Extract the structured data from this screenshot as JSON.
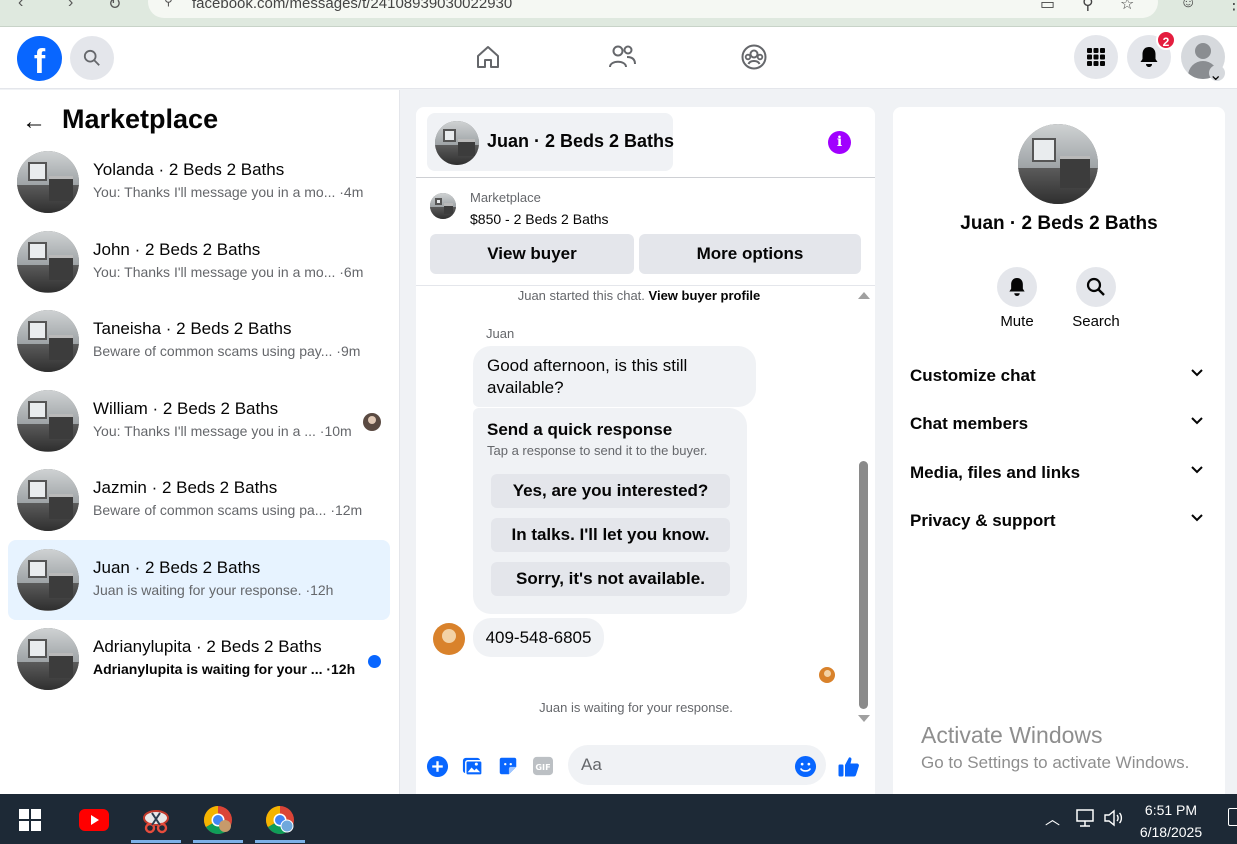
{
  "browser": {
    "url": "facebook.com/messages/t/24108939030022930"
  },
  "header": {
    "logo_letter": "f",
    "notification_count": "2"
  },
  "sidebar": {
    "title": "Marketplace",
    "conversations": [
      {
        "name": "Yolanda · 2 Beds 2 Baths",
        "preview": "You: Thanks I'll message you in a mo... ·4m",
        "active": false,
        "unread": false,
        "seen_avatar": false
      },
      {
        "name": "John · 2 Beds 2 Baths",
        "preview": "You: Thanks I'll message you in a mo... ·6m",
        "active": false,
        "unread": false,
        "seen_avatar": false
      },
      {
        "name": "Taneisha · 2 Beds 2 Baths",
        "preview": "Beware of common scams using pay... ·9m",
        "active": false,
        "unread": false,
        "seen_avatar": false
      },
      {
        "name": "William · 2 Beds 2 Baths",
        "preview": "You: Thanks I'll message you in a ... ·10m",
        "active": false,
        "unread": false,
        "seen_avatar": true
      },
      {
        "name": "Jazmin · 2 Beds 2 Baths",
        "preview": "Beware of common scams using pa... ·12m",
        "active": false,
        "unread": false,
        "seen_avatar": false
      },
      {
        "name": "Juan · 2 Beds 2 Baths",
        "preview": "Juan is waiting for your response. ·12h",
        "active": true,
        "unread": false,
        "seen_avatar": false
      },
      {
        "name": "Adrianylupita · 2 Beds 2 Baths",
        "preview": "Adrianylupita is waiting for your ... ·12h",
        "active": false,
        "unread": true,
        "seen_avatar": false
      }
    ]
  },
  "chat": {
    "title": "Juan · 2 Beds 2 Baths",
    "listing_label": "Marketplace",
    "listing_price": "$850 - 2 Beds 2 Baths",
    "view_buyer": "View buyer",
    "more_options": "More options",
    "started_text": "Juan started this chat.",
    "buyer_profile_link": "View buyer profile",
    "sender_name": "Juan",
    "message_1": "Good afternoon, is this still available?",
    "quick_response": {
      "title": "Send a quick response",
      "subtitle": "Tap a response to send it to the buyer.",
      "options": [
        "Yes, are you interested?",
        "In talks. I'll let you know.",
        "Sorry, it's not available."
      ]
    },
    "message_2": "409-548-6805",
    "waiting_text": "Juan is waiting for your response.",
    "composer_placeholder": "Aa"
  },
  "details": {
    "name": "Juan · 2 Beds 2 Baths",
    "mute_label": "Mute",
    "search_label": "Search",
    "sections": [
      "Customize chat",
      "Chat members",
      "Media, files and links",
      "Privacy & support"
    ]
  },
  "watermark": {
    "line1": "Activate Windows",
    "line2": "Go to Settings to activate Windows."
  },
  "taskbar": {
    "time": "6:51 PM",
    "date": "6/18/2025"
  },
  "colors": {
    "brand": "#0866ff",
    "info": "#a100ff",
    "active_row": "#e7f3ff"
  }
}
